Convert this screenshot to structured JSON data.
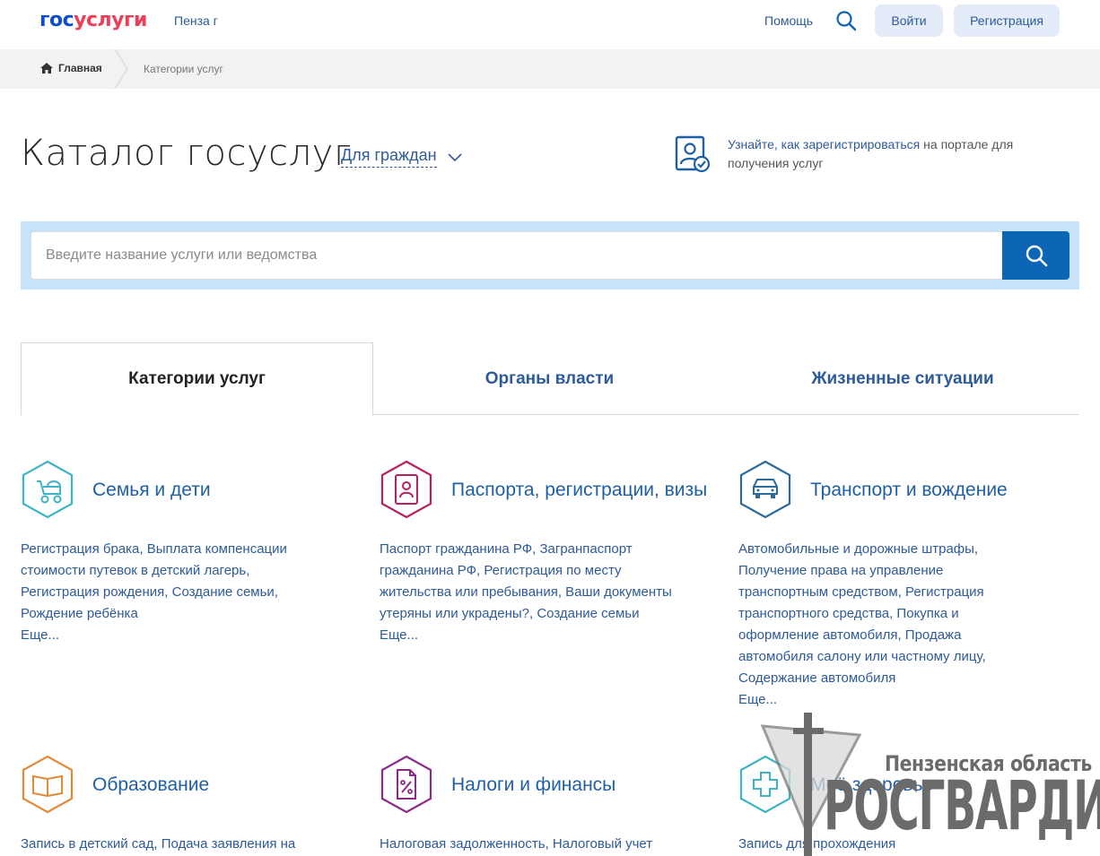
{
  "header": {
    "logo_part1": "гос",
    "logo_part2": "услуги",
    "region": "Пенза г",
    "help": "Помощь",
    "login": "Войти",
    "register": "Регистрация"
  },
  "breadcrumb": {
    "home": "Главная",
    "current": "Категории услуг"
  },
  "page": {
    "title": "Каталог госуслуг",
    "audience": "Для граждан",
    "reg_link": "Узнайте, как зарегистрироваться",
    "reg_rest": " на портале для получения услуг"
  },
  "search": {
    "placeholder": "Введите название услуги или ведомства"
  },
  "tabs": [
    {
      "label": "Категории услуг"
    },
    {
      "label": "Органы власти"
    },
    {
      "label": "Жизненные ситуации"
    }
  ],
  "categories": [
    {
      "title": "Семья и дети",
      "icon": "stroller-icon",
      "color": "#3fb3c6",
      "links": "Регистрация брака, Выплата компенсации стоимости путевок в детский лагерь, Регистрация рождения, Создание семьи, Рождение ребёнка",
      "more": "Еще..."
    },
    {
      "title": "Паспорта, регистрации, визы",
      "icon": "passport-icon",
      "color": "#b81f5e",
      "links": "Паспорт гражданина РФ, Загранпаспорт гражданина РФ, Регистрация по месту жительства или пребывания, Ваши документы утеряны или украдены?, Создание семьи",
      "more": "Еще..."
    },
    {
      "title": "Транспорт и вождение",
      "icon": "car-icon",
      "color": "#2c6a9b",
      "links": "Автомобильные и дорожные штрафы, Получение права на управление транспортным средством, Регистрация транспортного средства, Покупка и оформление автомобиля, Продажа автомобиля салону или частному лицу, Содержание автомобиля",
      "more": "Еще..."
    },
    {
      "title": "Образование",
      "icon": "book-icon",
      "color": "#e08a3a",
      "links": "Запись в детский сад, Подача заявления на",
      "more": ""
    },
    {
      "title": "Налоги и финансы",
      "icon": "tax-document-icon",
      "color": "#8c2a8c",
      "links": "Налоговая задолженность, Налоговый учет",
      "more": ""
    },
    {
      "title": "Моё здоровье",
      "icon": "medical-cross-icon",
      "color": "#3fb3c6",
      "links": "Запись для прохождения",
      "more": ""
    }
  ],
  "watermark": {
    "line1": "Пензенская область",
    "line2": "РОСГВАРДИЯ"
  }
}
